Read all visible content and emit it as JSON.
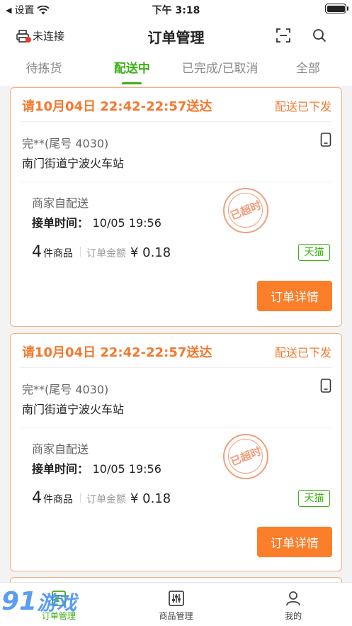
{
  "status": {
    "back_label": "设置",
    "time": "下午 3:18"
  },
  "nav": {
    "printer_label": "未连接",
    "title": "订单管理"
  },
  "tabs": [
    {
      "label": "待拣货"
    },
    {
      "label": "配送中"
    },
    {
      "label": "已完成/已取消"
    },
    {
      "label": "全部"
    }
  ],
  "orders": [
    {
      "eta": "请10月04日 22:42-22:57送达",
      "state": "配送已下发",
      "customer": "完**(尾号 4030)",
      "address": "南门街道宁波火车站",
      "delivery": "商家自配送",
      "accept_label": "接单时间：",
      "accept_time": "10/05 19:56",
      "stamp": "已超时",
      "count": "4",
      "count_unit": "件商品",
      "amount_label": "订单金额",
      "amount": "¥ 0.18",
      "platform": "天猫",
      "detail_label": "订单详情"
    },
    {
      "eta": "请10月04日 22:42-22:57送达",
      "state": "配送已下发",
      "customer": "完**(尾号 4030)",
      "address": "南门街道宁波火车站",
      "delivery": "商家自配送",
      "accept_label": "接单时间：",
      "accept_time": "10/05 19:56",
      "stamp": "已超时",
      "count": "4",
      "count_unit": "件商品",
      "amount_label": "订单金额",
      "amount": "¥ 0.18",
      "platform": "天猫",
      "detail_label": "订单详情"
    }
  ],
  "bottom_nav": [
    {
      "label": "订单管理"
    },
    {
      "label": "商品管理"
    },
    {
      "label": "我的"
    }
  ],
  "watermark": {
    "brand": "91",
    "text": "游戏"
  },
  "colors": {
    "accent": "#3cb014",
    "orange": "#f5782e",
    "button": "#fb7e2a"
  }
}
